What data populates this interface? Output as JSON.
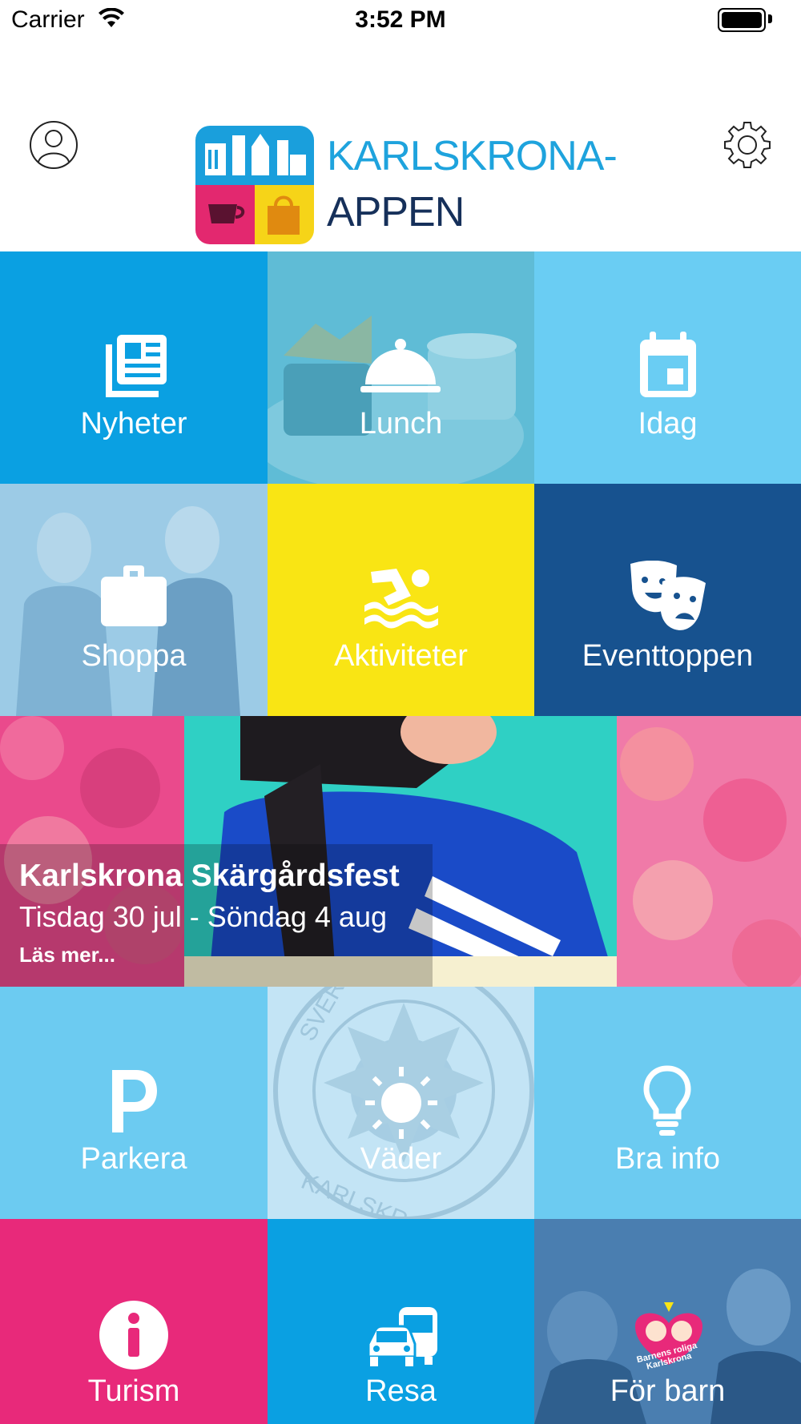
{
  "status_bar": {
    "carrier": "Carrier",
    "time": "3:52 PM"
  },
  "header": {
    "title": "KARLSKRONA-",
    "subtitle": "APPEN"
  },
  "tiles": [
    {
      "label": "Nyheter",
      "icon": "newspaper-icon",
      "color": "#0aa0e2"
    },
    {
      "label": "Lunch",
      "icon": "cloche-icon",
      "color": "#5fbcd6"
    },
    {
      "label": "Idag",
      "icon": "calendar-icon",
      "color": "#6acdf3"
    },
    {
      "label": "Shoppa",
      "icon": "briefcase-icon",
      "color": "#8fc4e4"
    },
    {
      "label": "Aktiviteter",
      "icon": "swimmer-icon",
      "color": "#f9e514"
    },
    {
      "label": "Eventtoppen",
      "icon": "theater-masks-icon",
      "color": "#17528f"
    },
    {
      "label": "Parkera",
      "icon": "parking-icon",
      "color": "#6ccbf1"
    },
    {
      "label": "Väder",
      "icon": "sun-icon",
      "color": "#c3e4f5"
    },
    {
      "label": "Bra info",
      "icon": "lightbulb-icon",
      "color": "#6ccbf1"
    },
    {
      "label": "Turism",
      "icon": "info-icon",
      "color": "#e8297a"
    },
    {
      "label": "Resa",
      "icon": "car-bus-icon",
      "color": "#0aa0e2"
    },
    {
      "label": "För barn",
      "icon": "kids-logo-icon",
      "color": "#3f74a8"
    }
  ],
  "banner": {
    "title": "Karlskrona Skärgårdsfest",
    "date": "Tisdag 30 jul - Söndag 4 aug",
    "more": "Läs mer..."
  },
  "kids_logo": {
    "line1": "Barnens roliga",
    "line2": "Karlskrona"
  },
  "weather_stamp": {
    "top": "SVER",
    "bottom": "KARLSKRONA"
  }
}
